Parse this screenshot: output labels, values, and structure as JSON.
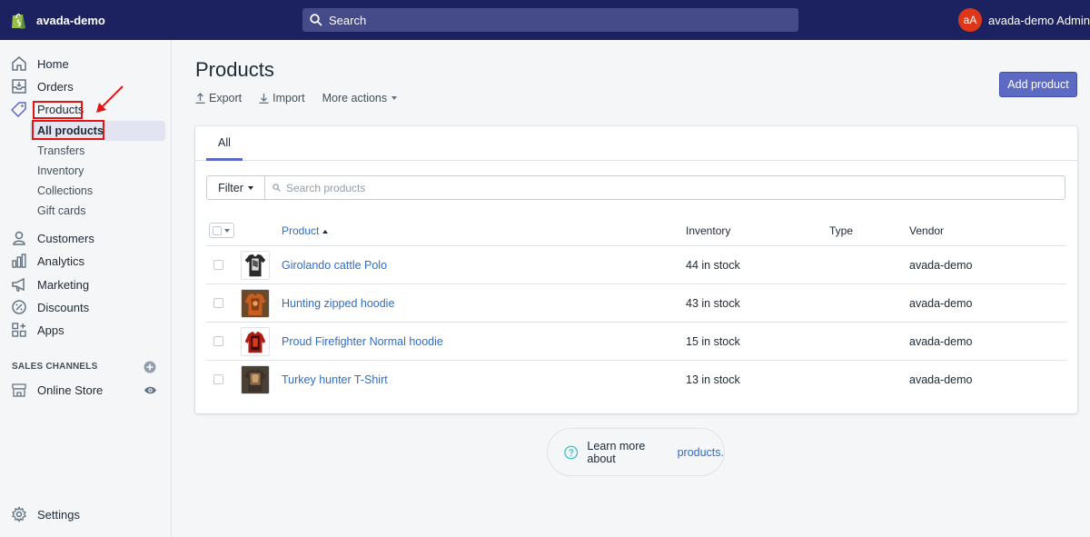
{
  "topbar": {
    "store_name": "avada-demo",
    "search_placeholder": "Search",
    "user_initials": "aA",
    "user_name": "avada-demo Admin",
    "bg_color": "#1c2260",
    "avatar_color": "#de3618"
  },
  "sidebar": {
    "items": [
      {
        "label": "Home",
        "icon": "home-icon"
      },
      {
        "label": "Orders",
        "icon": "orders-icon"
      },
      {
        "label": "Products",
        "icon": "tag-icon"
      },
      {
        "label": "Customers",
        "icon": "person-icon"
      },
      {
        "label": "Analytics",
        "icon": "bar-chart-icon"
      },
      {
        "label": "Marketing",
        "icon": "megaphone-icon"
      },
      {
        "label": "Discounts",
        "icon": "discount-icon"
      },
      {
        "label": "Apps",
        "icon": "apps-icon"
      }
    ],
    "product_subitems": [
      "All products",
      "Transfers",
      "Inventory",
      "Collections",
      "Gift cards"
    ],
    "sales_channels_title": "SALES CHANNELS",
    "channels": [
      {
        "label": "Online Store",
        "icon": "store-icon"
      }
    ],
    "settings_label": "Settings"
  },
  "main": {
    "title": "Products",
    "actions": {
      "export": "Export",
      "import": "Import",
      "more": "More actions"
    },
    "add_button": "Add product",
    "accent_color": "#5c6ac4",
    "tabs": [
      {
        "label": "All"
      }
    ],
    "filter_label": "Filter",
    "search_placeholder": "Search products",
    "columns": {
      "product": "Product",
      "inventory": "Inventory",
      "type": "Type",
      "vendor": "Vendor"
    },
    "products": [
      {
        "name": "Girolando cattle Polo",
        "inventory": "44 in stock",
        "type": "",
        "vendor": "avada-demo"
      },
      {
        "name": "Hunting zipped hoodie",
        "inventory": "43 in stock",
        "type": "",
        "vendor": "avada-demo"
      },
      {
        "name": "Proud Firefighter Normal hoodie",
        "inventory": "15 in stock",
        "type": "",
        "vendor": "avada-demo"
      },
      {
        "name": "Turkey hunter T-Shirt",
        "inventory": "13 in stock",
        "type": "",
        "vendor": "avada-demo"
      }
    ],
    "learn_more_text": "Learn more about",
    "learn_more_link": "products."
  },
  "annotation_color": "#e11515"
}
